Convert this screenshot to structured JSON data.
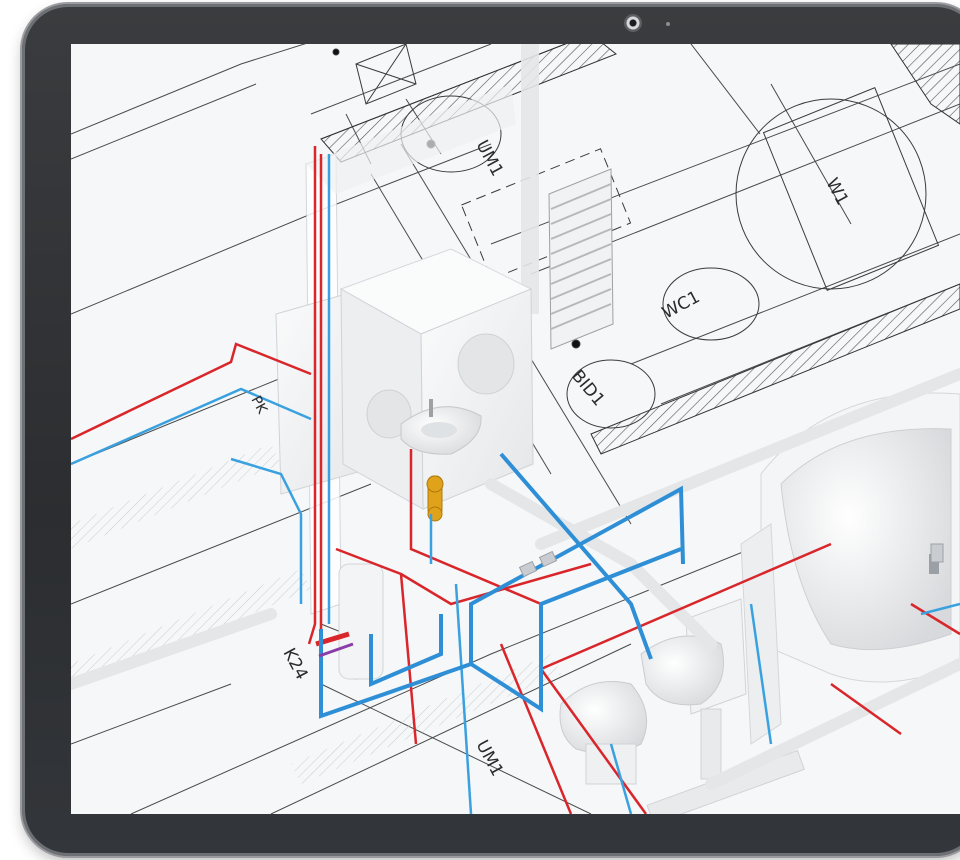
{
  "device": {
    "camera_icon": "camera-icon",
    "sensor_icon": "sensor-dot-icon"
  },
  "drawing": {
    "labels": {
      "um1_top": "UM1",
      "w1": "W1",
      "wc1": "WC1",
      "bidet": "BID1",
      "um1_bottom": "UM1",
      "k24": "K24",
      "pk": "PK"
    },
    "colors": {
      "hot_pipe": "#d8262b",
      "cold_pipe": "#3aa1e0",
      "fixture": "#e6e8ea",
      "valve": "#e0a21a",
      "linework": "#3b3b3b"
    }
  }
}
